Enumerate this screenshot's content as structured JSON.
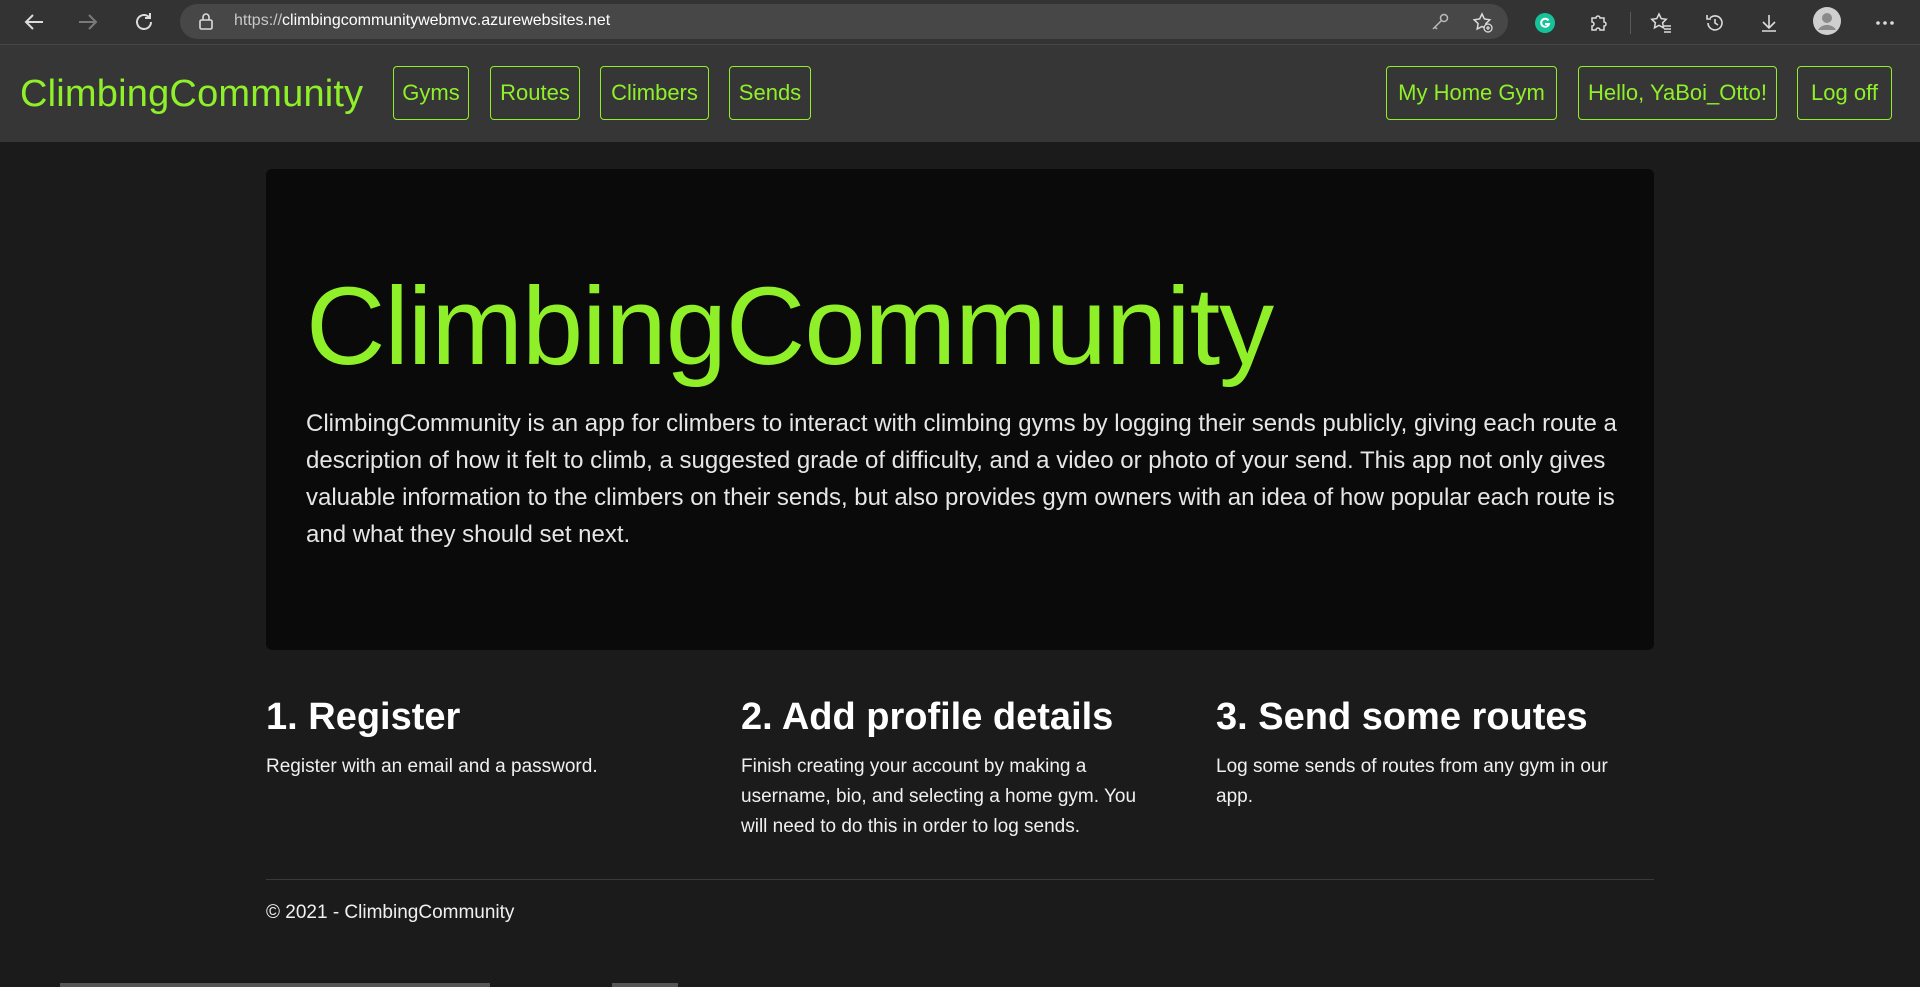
{
  "browser": {
    "url_scheme": "https://",
    "url_host": "climbingcommunitywebmvc.azurewebsites.net",
    "icons": {
      "back": "arrow-left-icon",
      "forward": "arrow-right-icon",
      "reload": "reload-icon",
      "lock": "lock-icon",
      "key": "key-icon",
      "favorite": "star-add-icon",
      "grammarly": "grammarly-icon",
      "extensions": "puzzle-icon",
      "favorites": "favorites-icon",
      "history": "history-icon",
      "downloads": "download-icon",
      "profile": "avatar-icon",
      "menu": "more-icon"
    }
  },
  "site": {
    "accent_color": "#8ff02a",
    "brand": "ClimbingCommunity",
    "nav_left": [
      "Gyms",
      "Routes",
      "Climbers",
      "Sends"
    ],
    "nav_right": [
      "My Home Gym",
      "Hello, YaBoi_Otto!",
      "Log off"
    ]
  },
  "jumbotron": {
    "title": "ClimbingCommunity",
    "text": "ClimbingCommunity is an app for climbers to interact with climbing gyms by logging their sends publicly, giving each route a description of how it felt to climb, a suggested grade of difficulty, and a video or photo of your send. This app not only gives valuable information to the climbers on their sends, but also provides gym owners with an idea of how popular each route is and what they should set next."
  },
  "steps": [
    {
      "title": "1. Register",
      "text": "Register with an email and a password."
    },
    {
      "title": "2. Add profile details",
      "text": "Finish creating your account by making a username, bio, and selecting a home gym. You will need to do this in order to log sends."
    },
    {
      "title": "3. Send some routes",
      "text": "Log some sends of routes from any gym in our app."
    }
  ],
  "footer": "© 2021 - ClimbingCommunity"
}
